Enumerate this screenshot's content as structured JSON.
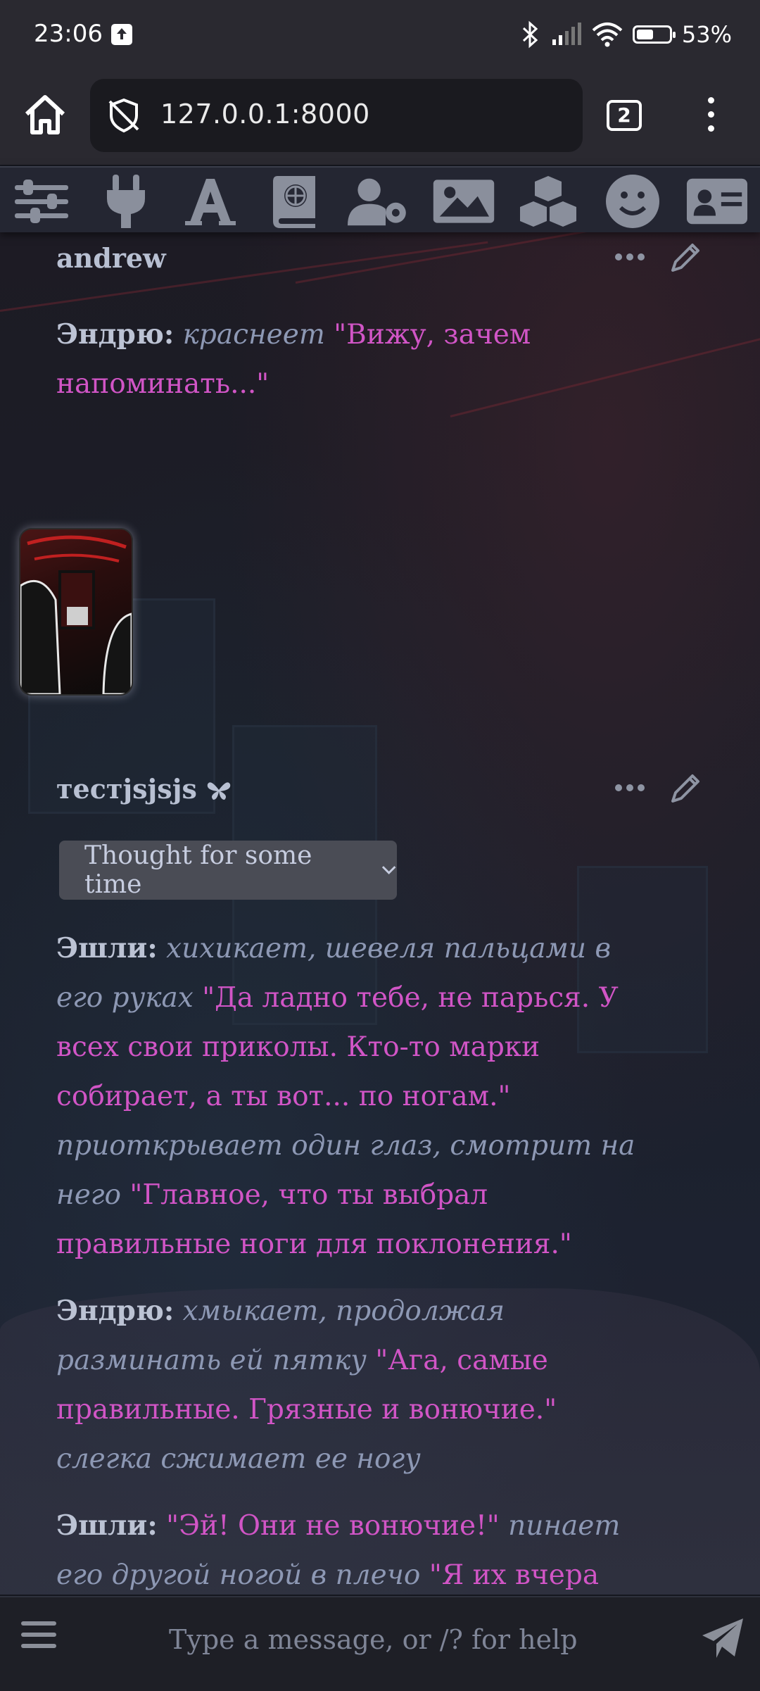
{
  "status_bar": {
    "time": "23:06",
    "battery_percent": "53%",
    "battery_level": 0.53
  },
  "browser": {
    "url": "127.0.0.1:8000",
    "tab_count": "2"
  },
  "toolbar": {
    "icons": [
      "sliders-icon",
      "plug-icon",
      "font-icon",
      "book-globe-icon",
      "user-gear-icon",
      "image-icon",
      "cubes-icon",
      "smile-icon",
      "id-card-icon"
    ]
  },
  "chat": {
    "messages": [
      {
        "author": "andrew",
        "lines": [
          {
            "speaker": "Эндрю:",
            "action": "краснеет",
            "speech": "\"Вижу, зачем напоминать...\""
          }
        ]
      },
      {
        "author": "тестjsjsjs",
        "thought_label": "Thought for some time",
        "p1": {
          "speaker": "Эшли:",
          "action1": "хихикает, шевеля пальцами в его руках",
          "speech1": "\"Да ладно тебе, не парься. У всех свои приколы. Кто-то марки собирает, а ты вот... по ногам.\"",
          "action2": "приоткрывает один глаз, смотрит на него",
          "speech2": "\"Главное, что ты выбрал правильные ноги для поклонения.\""
        },
        "p2": {
          "speaker": "Эндрю:",
          "action1": "хмыкает, продолжая разминать ей пятку",
          "speech1": "\"Ага, самые правильные. Грязные и вонючие.\"",
          "action2": "слегка сжимает ее ногу"
        },
        "p3": {
          "speaker": "Эшли:",
          "speech1": "\"Эй! Они не вонючие!\"",
          "action1": "пинает его другой ногой в плечо",
          "speech2": "\"Я их вчера мыла!"
        }
      }
    ]
  },
  "input": {
    "placeholder": "Type a message, or /? for help"
  }
}
